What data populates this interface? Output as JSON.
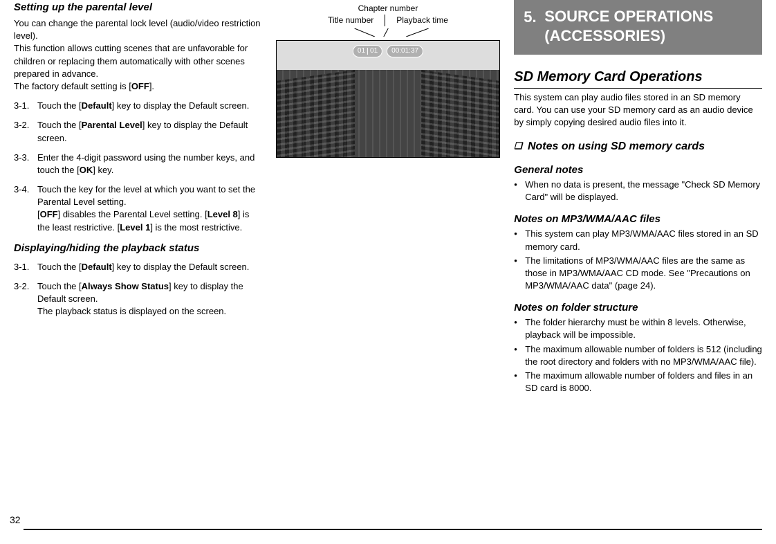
{
  "pageNumber": "32",
  "left": {
    "parentalHeading": "Setting up the parental level",
    "parentalPara1": "You can change the parental lock level (audio/video restriction level).",
    "parentalPara2a": "This function allows cutting scenes that are unfavorable for children or replacing them automatically with other scenes prepared in advance.",
    "parentalPara2b_pre": "The factory default setting is [",
    "parentalPara2b_bold": "OFF",
    "parentalPara2b_post": "].",
    "steps1": [
      {
        "num": "3-1.",
        "pre": "Touch the [",
        "bold": "Default",
        "post": "] key to display the Default screen."
      },
      {
        "num": "3-2.",
        "pre": "Touch the [",
        "bold": "Parental Level",
        "post": "] key to display the Default screen."
      },
      {
        "num": "3-3.",
        "pre": "Enter the 4-digit password using the number keys, and touch the [",
        "bold": "OK",
        "post": "] key."
      }
    ],
    "step34": {
      "num": "3-4.",
      "line1": "Touch the key for the level at which you want to set the Parental Level setting.",
      "l2_pre": "[",
      "l2_b1": "OFF",
      "l2_mid1": "] disables the Parental Level setting. [",
      "l2_b2": "Level 8",
      "l2_mid2": "] is the least restrictive. [",
      "l2_b3": "Level 1",
      "l2_post": "] is the most restrictive."
    },
    "displayHeading": "Displaying/hiding the playback status",
    "steps2": [
      {
        "num": "3-1.",
        "pre": "Touch the [",
        "bold": "Default",
        "post": "] key to display the Default screen."
      }
    ],
    "step2_2": {
      "num": "3-2.",
      "pre": "Touch the [",
      "bold": "Always Show Status",
      "post": "] key to display the Default screen.",
      "line2": "The playback status is displayed on the screen."
    }
  },
  "middle": {
    "chapterLabel": "Chapter number",
    "titleLabel": "Title number",
    "playbackLabel": "Playback time",
    "overlayTitle": "01",
    "overlayChapter": "01",
    "overlayTime": "00:01:37"
  },
  "right": {
    "sectionNum": "5.",
    "sectionTitle": "SOURCE OPERATIONS (ACCESSORIES)",
    "sdHeading": "SD Memory Card Operations",
    "sdPara": "This system can play audio files stored in an SD memory card. You can use your SD memory card as an audio device by simply copying desired audio files into it.",
    "notesSymbol": "❏",
    "notesHeading": "Notes on using SD memory cards",
    "general": {
      "title": "General notes",
      "bullets": [
        "When no data is present, the message \"Check SD Memory Card\" will be displayed."
      ]
    },
    "mp3": {
      "title": "Notes on MP3/WMA/AAC files",
      "bullets": [
        "This system can play MP3/WMA/AAC files stored in an SD memory card.",
        "The limitations of MP3/WMA/AAC files are the same as those in MP3/WMA/AAC CD mode. See \"Precautions on MP3/WMA/AAC data\" (page 24)."
      ]
    },
    "folder": {
      "title": "Notes on folder structure",
      "bullets": [
        "The folder hierarchy must be within 8 levels. Otherwise, playback will be impossible.",
        "The maximum allowable number of folders is 512 (including the root directory and folders with no MP3/WMA/AAC file).",
        "The maximum allowable number of folders and files in an SD card is 8000."
      ]
    }
  }
}
